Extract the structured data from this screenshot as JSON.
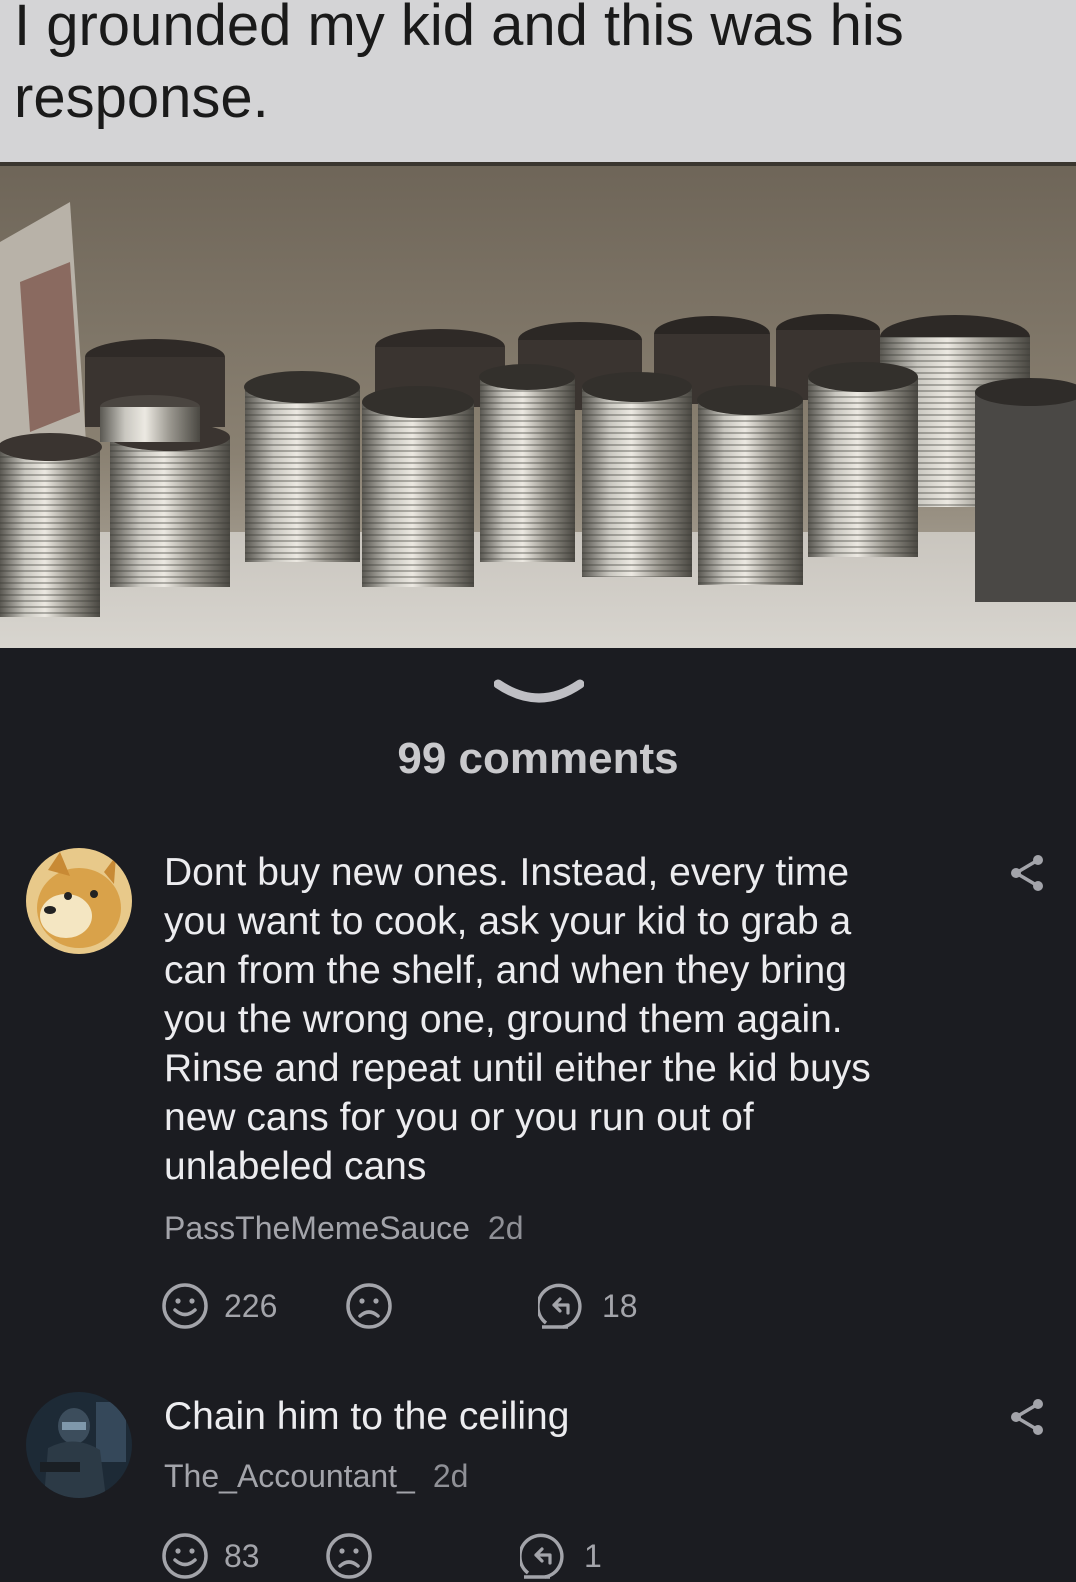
{
  "meme": {
    "caption_line1": "I grounded my kid and this was his",
    "caption_line2": "response."
  },
  "comments_header": "99 comments",
  "comments": [
    {
      "text": "Dont buy new ones. Instead, every time you want to cook, ask your kid to grab a can from the shelf, and when they bring you the wrong one, ground them again. Rinse and repeat until either the kid buys new cans for you or you run out of unlabeled cans",
      "author": "PassTheMemeSauce",
      "age": "2d",
      "likes": "226",
      "replies": "18"
    },
    {
      "text": "Chain him to the ceiling",
      "author": "The_Accountant_",
      "age": "2d",
      "likes": "83",
      "replies": "1"
    }
  ],
  "icons": {
    "collapse": "chevron-down-icon",
    "share": "share-icon",
    "like": "smiley-icon",
    "dislike": "frown-icon",
    "reply": "reply-icon"
  },
  "colors": {
    "background": "#1b1c21",
    "caption_bg": "#d4d4d6",
    "meta_text": "#a3a4aa"
  }
}
